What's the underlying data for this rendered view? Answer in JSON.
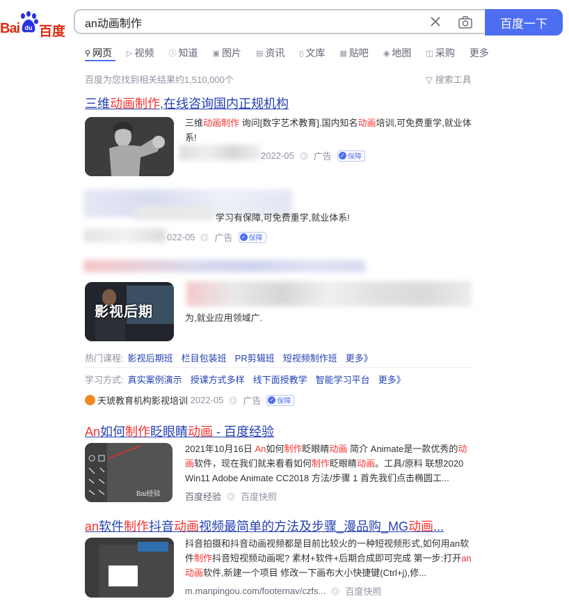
{
  "logo": {
    "text_left": "Bai",
    "text_right": "百度"
  },
  "search": {
    "query": "an动画制作",
    "button": "百度一下"
  },
  "tabs": [
    {
      "label": "网页",
      "icon": "search-icon"
    },
    {
      "label": "视频",
      "icon": "video-icon"
    },
    {
      "label": "知道",
      "icon": "question-icon"
    },
    {
      "label": "图片",
      "icon": "image-icon"
    },
    {
      "label": "资讯",
      "icon": "news-icon"
    },
    {
      "label": "文库",
      "icon": "doc-icon"
    },
    {
      "label": "贴吧",
      "icon": "tieba-icon"
    },
    {
      "label": "地图",
      "icon": "map-icon"
    },
    {
      "label": "采购",
      "icon": "shop-icon"
    },
    {
      "label": "更多",
      "icon": ""
    }
  ],
  "stats": {
    "count": "百度为您找到相关结果约1,510,000个",
    "tools": "搜索工具"
  },
  "results": {
    "r1": {
      "title": [
        "三维",
        "动画制作",
        ",在线咨询国内正规机构"
      ],
      "desc": [
        "三维",
        "动画制作",
        " 询问[数字艺术教育].国内知名",
        "动画",
        "培训,可免费重学,就业体系!"
      ],
      "date": "2022-05",
      "ad": "广告",
      "badge": "保障"
    },
    "r2": {
      "desc": "学习有保障,可免费重学,就业体系!",
      "date": "022-05",
      "ad": "广告",
      "badge": "保障"
    },
    "r3": {
      "thumb_text": "影视后期",
      "desc": "为,就业应用领域广.",
      "hot_label": "热门课程:",
      "hot": [
        "影视后期班",
        "栏目包装班",
        "PR剪辑班",
        "短视频制作班",
        "更多》"
      ],
      "mode_label": "学习方式:",
      "modes": [
        "真实案例演示",
        "授课方式多样",
        "线下面授教学",
        "智能学习平台",
        "更多》"
      ],
      "source": "天琥教育机构影视培训",
      "date": "2022-05",
      "ad": "广告",
      "badge": "保障"
    },
    "r4": {
      "title": [
        "An",
        "如何",
        "制作",
        "眨眼睛",
        "动画",
        " - 百度经验"
      ],
      "desc": [
        "2021年10月16日 ",
        "An",
        "如何",
        "制作",
        "眨眼睛",
        "动画",
        " 简介 Animate是一款优秀的",
        "动画",
        "软件，现在我们就来看看如何",
        "制作",
        "眨眼睛",
        "动画",
        "。工具/原料 联想2020 Win11 Adobe Animate CC2018 方法/步骤 1 首先我们点击椭圆工..."
      ],
      "source": "百度经验",
      "cache": "百度快照",
      "thumb_logo": "Bai经验"
    },
    "r5": {
      "title": [
        "an",
        "软件",
        "制作",
        "抖音",
        "动画",
        "视频最简单的方法及步骤_漫品购_MG",
        "动画",
        "..."
      ],
      "desc": [
        "抖音拍摄和抖音动画视频都是目前比较火的一种短视频形式,如何用an软件",
        "制作",
        "抖音短视频动画呢? 素材+软件+后期合成即可完成 第一步:打开",
        "an",
        "动画",
        "软件,新建一个项目 修改一下画布大小快捷键(Ctrl+j),修..."
      ],
      "url": "m.manpingou.com/footernav/czfs...",
      "cache": "百度快照"
    }
  },
  "colors": {
    "accent": "#4e6ef2",
    "link": "#2440b3",
    "highlight": "#f73131",
    "meta": "#9195a3"
  }
}
